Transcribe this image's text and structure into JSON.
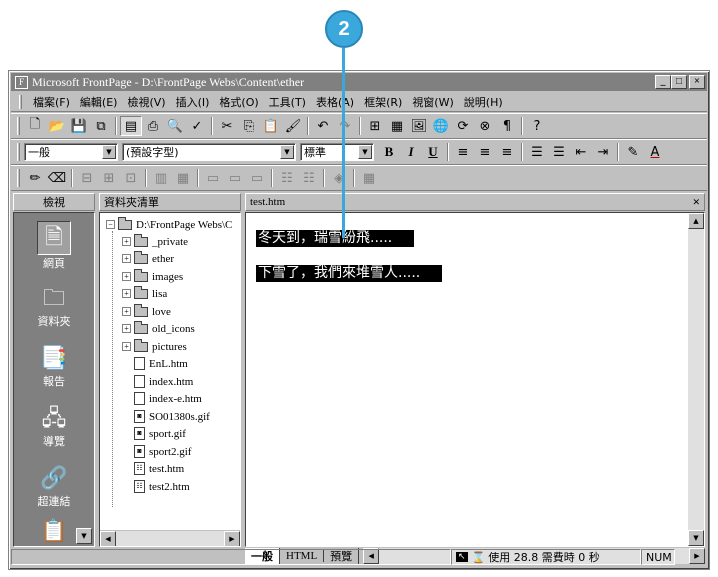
{
  "callout": {
    "number": "2"
  },
  "window": {
    "title": "Microsoft FrontPage - D:\\FrontPage Webs\\Content\\ether",
    "app_icon": "frontpage-app-icon",
    "buttons": {
      "minimize": "_",
      "maximize": "□",
      "close": "×"
    }
  },
  "menubar": {
    "items": [
      "檔案(F)",
      "編輯(E)",
      "檢視(V)",
      "插入(I)",
      "格式(O)",
      "工具(T)",
      "表格(A)",
      "框架(R)",
      "視窗(W)",
      "說明(H)"
    ]
  },
  "toolbar_format": {
    "style_value": "一般",
    "font_value": "(預設字型)",
    "size_value": "標準",
    "bold": "B",
    "italic": "I",
    "underline": "U",
    "pilcrow": "¶"
  },
  "views_pane": {
    "header": "檢視",
    "items": [
      {
        "label": "網頁",
        "icon": "page-icon"
      },
      {
        "label": "資料夾",
        "icon": "folder-icon"
      },
      {
        "label": "報告",
        "icon": "reports-icon"
      },
      {
        "label": "導覽",
        "icon": "navigation-icon"
      },
      {
        "label": "超連結",
        "icon": "hyperlinks-icon"
      }
    ]
  },
  "folders_pane": {
    "header": "資料夾清單",
    "root": "D:\\FrontPage Webs\\C",
    "folders": [
      "_private",
      "ether",
      "images",
      "lisa",
      "love",
      "old_icons",
      "pictures"
    ],
    "files": [
      "EnL.htm",
      "index.htm",
      "index-e.htm",
      "SO01380s.gif",
      "sport.gif",
      "sport2.gif",
      "test.htm",
      "test2.htm"
    ]
  },
  "editor": {
    "tab_title": "test.htm",
    "close": "×",
    "lines": [
      "冬天到，瑞雪紛飛.....",
      "下雪了，我們來堆雪人....."
    ],
    "tabs": [
      "一般",
      "HTML",
      "預覽"
    ]
  },
  "statusbar": {
    "message": "使用 28.8 需費時 0 秒",
    "num": "NUM"
  }
}
